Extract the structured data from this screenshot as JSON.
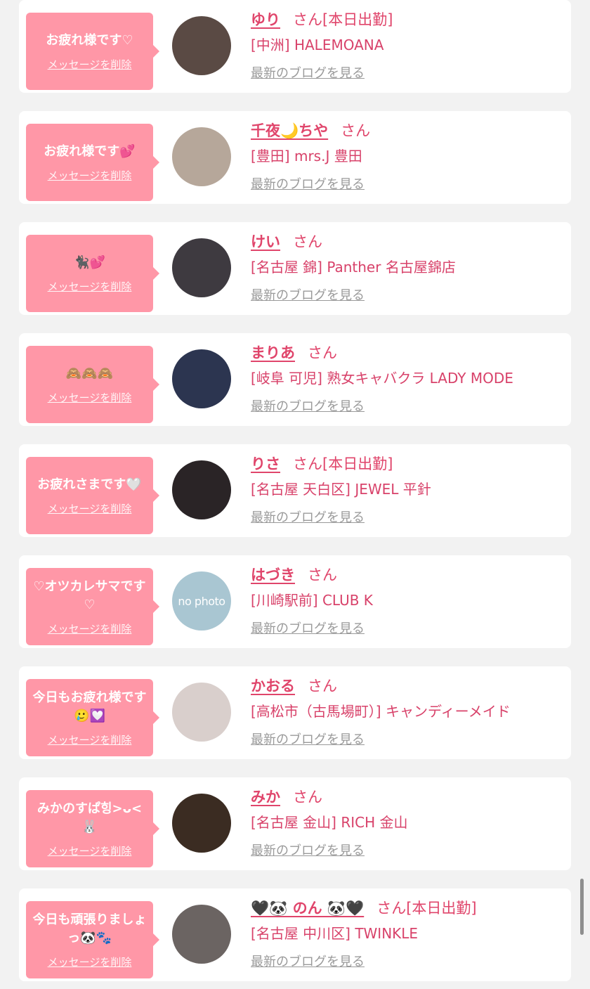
{
  "common": {
    "san": "さん",
    "delete_label": "メッセージを削除",
    "blog_label": "最新のブログを見る"
  },
  "cards": [
    {
      "message": "お疲れ様です♡",
      "name": "ゆり",
      "status": "[本日出勤]",
      "shop": "[中洲] HALEMOANA",
      "avatar_color": "#5a4a44",
      "avatar_alt": ""
    },
    {
      "message": "お疲れ様です💕",
      "name": "千夜🌙ちや",
      "status": "",
      "shop": "[豊田] mrs.J 豊田",
      "avatar_color": "#b6a79a",
      "avatar_alt": ""
    },
    {
      "message": "🐈‍⬛💕",
      "name": "けい",
      "status": "",
      "shop": "[名古屋 錦] Panther 名古屋錦店",
      "avatar_color": "#3e3a40",
      "avatar_alt": ""
    },
    {
      "message": "🙈🙈🙈",
      "name": "まりあ",
      "status": "",
      "shop": "[岐阜 可児] 熟女キャバクラ LADY MODE",
      "avatar_color": "#2c3550",
      "avatar_alt": ""
    },
    {
      "message": "お疲れさまです🤍",
      "name": "りさ",
      "status": "[本日出勤]",
      "shop": "[名古屋 天白区] JEWEL 平針",
      "avatar_color": "#2a2426",
      "avatar_alt": ""
    },
    {
      "message": "♡オツカレサマです♡",
      "name": "はづき",
      "status": "",
      "shop": "[川崎駅前] CLUB K",
      "avatar_color": "#a9c6d2",
      "avatar_alt": "no photo"
    },
    {
      "message": "今日もお疲れ様です🥲💟",
      "name": "かおる",
      "status": "",
      "shop": "[高松市（古馬場町）] キャンディーメイド",
      "avatar_color": "#d9cfcc",
      "avatar_alt": ""
    },
    {
      "message": "みかのすぱ힝>ᴗ<🐰",
      "name": "みか",
      "status": "",
      "shop": "[名古屋 金山] RICH 金山",
      "avatar_color": "#3b2c22",
      "avatar_alt": ""
    },
    {
      "message": "今日も頑張りましょっ🐼🐾",
      "name": "🖤🐼 のん 🐼🖤",
      "status": "[本日出勤]",
      "shop": "[名古屋 中川区] TWINKLE",
      "avatar_color": "#6b6462",
      "avatar_alt": ""
    }
  ]
}
